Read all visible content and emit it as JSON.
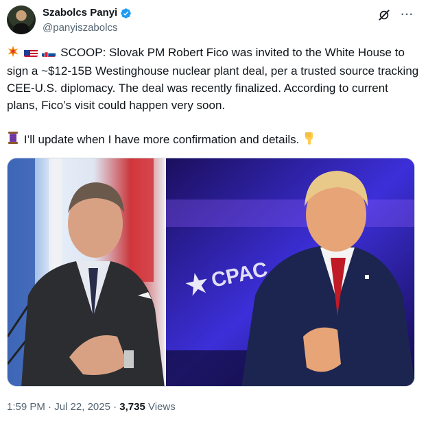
{
  "author": {
    "display_name": "Szabolcs Panyi",
    "handle": "@panyiszabolcs",
    "verified": true
  },
  "icons": {
    "verified": "verified-badge-icon",
    "grok": "grok-icon",
    "more": "more-options-icon"
  },
  "more_label": "···",
  "tweet": {
    "paragraph1": "SCOOP: Slovak PM Robert Fico was invited to the White House to sign a ~$12-15B Westinghouse nuclear plant deal, per a trusted source tracking CEE-U.S. diplomacy. The deal was recently finalized. According to current plans, Fico’s visit could happen very soon.",
    "paragraph2": "I’ll update when I have more confirmation and details."
  },
  "media": {
    "left_photo": "Robert Fico speaking in front of flags",
    "right_photo": "Donald Trump at CPAC stage",
    "cpac_sign": "CPAC"
  },
  "meta": {
    "time": "1:59 PM",
    "separator": " · ",
    "date": "Jul 22, 2025",
    "views_count": "3,735",
    "views_label": " Views"
  },
  "colors": {
    "verified_blue": "#1d9bf0",
    "text_secondary": "#536471"
  }
}
